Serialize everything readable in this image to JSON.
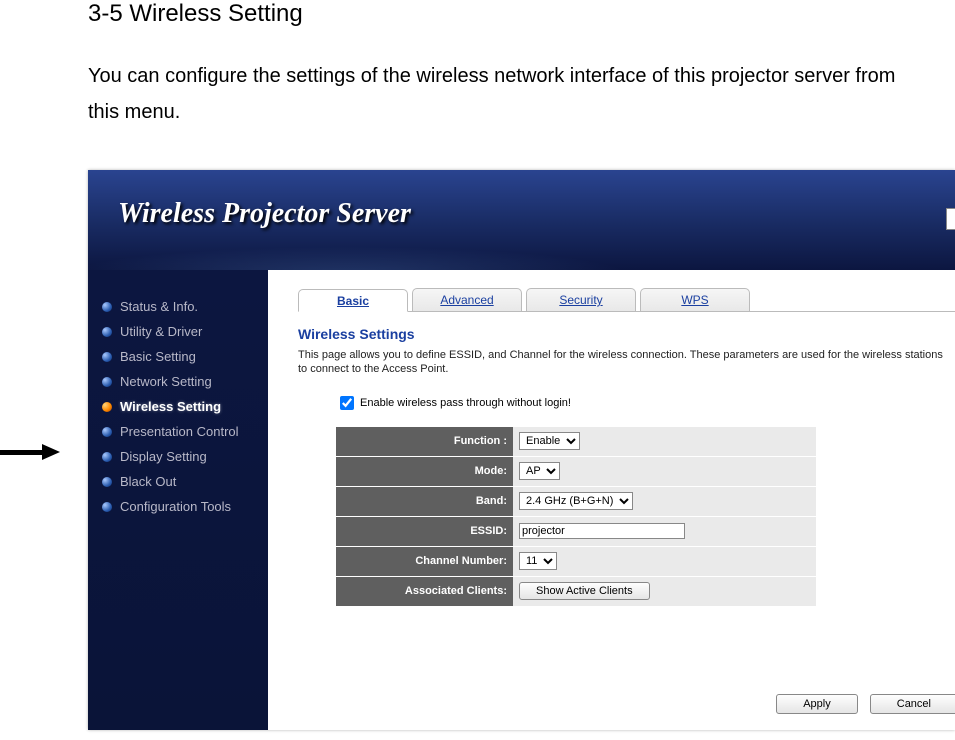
{
  "doc": {
    "heading": "3-5 Wireless Setting",
    "paragraph": "You can configure the settings of the wireless network interface of this projector server from this menu."
  },
  "app": {
    "title": "Wireless Projector Server"
  },
  "sidebar": {
    "items": [
      {
        "label": "Status & Info."
      },
      {
        "label": "Utility & Driver"
      },
      {
        "label": "Basic Setting"
      },
      {
        "label": "Network Setting"
      },
      {
        "label": "Wireless Setting"
      },
      {
        "label": "Presentation Control"
      },
      {
        "label": "Display Setting"
      },
      {
        "label": "Black Out"
      },
      {
        "label": "Configuration Tools"
      }
    ]
  },
  "tabs": {
    "items": [
      {
        "label": "Basic"
      },
      {
        "label": "Advanced"
      },
      {
        "label": "Security"
      },
      {
        "label": "WPS"
      }
    ]
  },
  "section": {
    "title": "Wireless Settings",
    "description": "This page allows you to define ESSID, and Channel for the wireless connection. These parameters are used for the wireless stations to connect to the Access Point.",
    "checkbox_label": "Enable wireless pass through without login!"
  },
  "fields": {
    "function_label": "Function :",
    "function_value": "Enable",
    "mode_label": "Mode:",
    "mode_value": "AP",
    "band_label": "Band:",
    "band_value": "2.4 GHz (B+G+N)",
    "essid_label": "ESSID:",
    "essid_value": "projector",
    "channel_label": "Channel Number:",
    "channel_value": "11",
    "clients_label": "Associated Clients:",
    "clients_button": "Show Active Clients"
  },
  "buttons": {
    "apply": "Apply",
    "cancel": "Cancel"
  }
}
